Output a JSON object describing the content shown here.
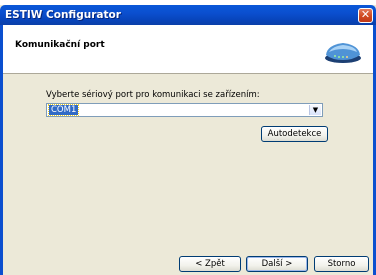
{
  "window": {
    "title": "ESTIW Configurator",
    "close_glyph": "✕",
    "close_icon": "close-icon"
  },
  "header": {
    "title": "Komunikační port",
    "icon": "modem-icon"
  },
  "form": {
    "prompt": "Vyberte sériový port pro komunikaci se zařízením:",
    "port_select": {
      "value": "COM1",
      "arrow_glyph": "▼",
      "arrow_icon": "chevron-down-icon"
    },
    "autodetect_label": "Autodetekce"
  },
  "footer": {
    "back_label": "< Zpět",
    "next_label": "Další >",
    "cancel_label": "Storno"
  },
  "colors": {
    "titlebar": "#0b4fcf",
    "selection": "#316ac5",
    "dialog_bg": "#ece9d8"
  }
}
